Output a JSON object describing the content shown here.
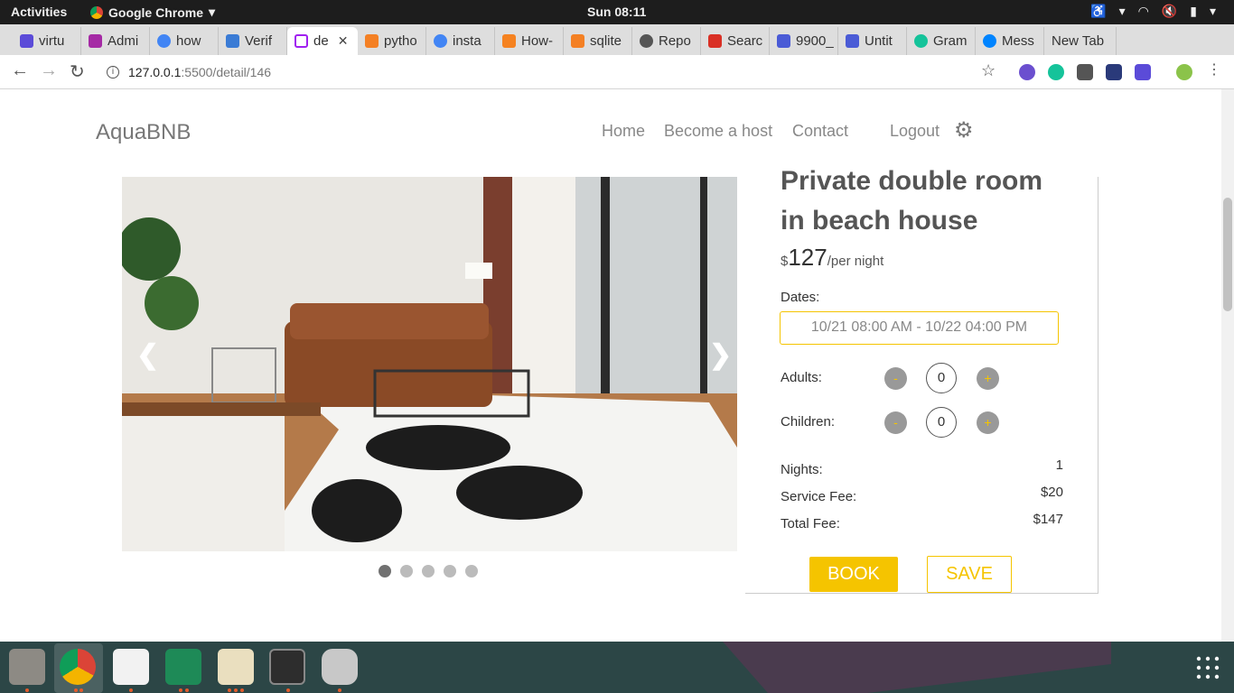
{
  "topbar": {
    "activities": "Activities",
    "app_name": "Google Chrome",
    "clock": "Sun 08:11"
  },
  "tabs": [
    {
      "label": "virtu",
      "color": "#5b4bd8"
    },
    {
      "label": "Admi",
      "color": "#a52aa5"
    },
    {
      "label": "how",
      "color": "#4285f4"
    },
    {
      "label": "Verif",
      "color": "#3a7bd5"
    },
    {
      "label": "de",
      "color": "#a020f0",
      "active": true
    },
    {
      "label": "pytho",
      "color": "#f48024"
    },
    {
      "label": "insta",
      "color": "#4285f4"
    },
    {
      "label": "How-",
      "color": "#f58220"
    },
    {
      "label": "sqlite",
      "color": "#f48024"
    },
    {
      "label": "Repo",
      "color": "#555555"
    },
    {
      "label": "Searc",
      "color": "#d93025"
    },
    {
      "label": "9900_",
      "color": "#4a5bd6"
    },
    {
      "label": "Untit",
      "color": "#4a5bd6"
    },
    {
      "label": "Gram",
      "color": "#15c39a"
    },
    {
      "label": "Mess",
      "color": "#0084ff"
    },
    {
      "label": "New Tab",
      "color": ""
    }
  ],
  "toolbar": {
    "url_host": "127.0.0.1",
    "url_path": ":5500/detail/146"
  },
  "site": {
    "brand": "AquaBNB",
    "nav": {
      "home": "Home",
      "host": "Become a host",
      "contact": "Contact",
      "logout": "Logout"
    }
  },
  "carousel": {
    "prev": "❮",
    "next": "❯",
    "slide_count": 5,
    "active_slide": 0
  },
  "listing": {
    "title": "Private double room in beach house",
    "currency": "$",
    "price": "127",
    "per_night": "/per night",
    "dates_label": "Dates:",
    "dates_value": "10/21 08:00 AM - 10/22 04:00 PM",
    "adults_label": "Adults:",
    "adults": "0",
    "children_label": "Children:",
    "children": "0",
    "minus": "-",
    "plus": "+",
    "nights_label": "Nights:",
    "nights": "1",
    "service_label": "Service Fee:",
    "service": "$20",
    "total_label": "Total Fee:",
    "total": "$147",
    "book": "BOOK",
    "save": "SAVE"
  },
  "colors": {
    "accent": "#f5c400"
  }
}
